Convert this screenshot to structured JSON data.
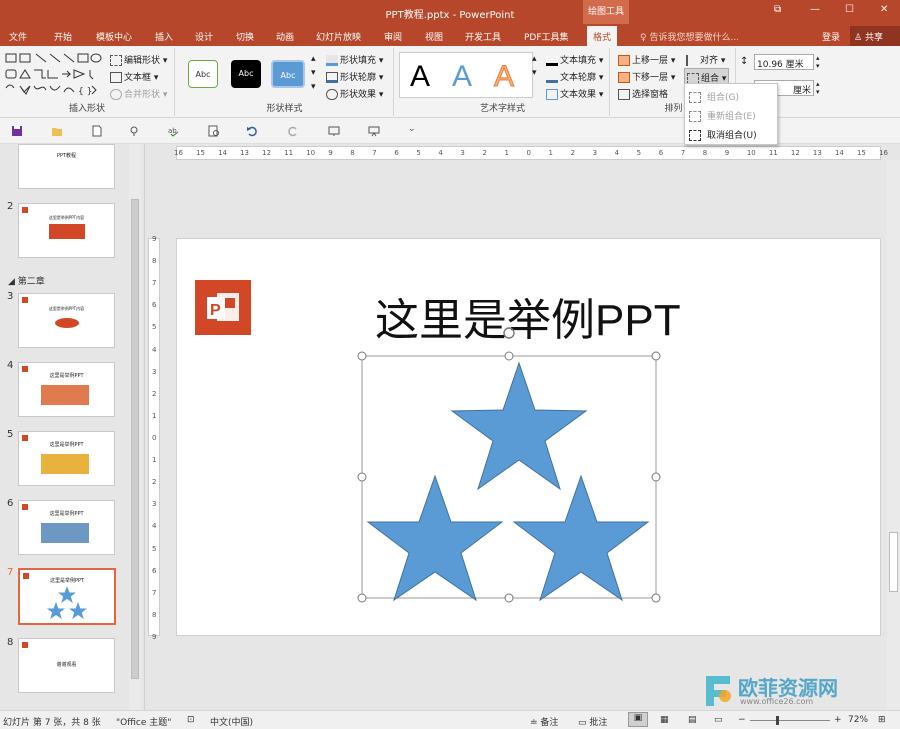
{
  "window": {
    "title": "PPT教程.pptx - PowerPoint",
    "context_tool": "绘图工具",
    "controls": {
      "restore": "⧉",
      "minimize": "—",
      "maximize": "☐",
      "close": "✕"
    }
  },
  "tabs": [
    "文件",
    "开始",
    "模板中心",
    "插入",
    "设计",
    "切换",
    "动画",
    "幻灯片放映",
    "审阅",
    "视图",
    "开发工具",
    "PDF工具集",
    "格式"
  ],
  "tell_me": "告诉我您想要做什么...",
  "login": "登录",
  "share": "共享",
  "ribbon": {
    "insert_shapes": {
      "label": "插入形状",
      "edit_shape": "编辑形状",
      "text_box": "文本框",
      "merge_shapes": "合并形状"
    },
    "shape_styles": {
      "label": "形状样式",
      "preset_1": "Abc",
      "preset_2": "Abc",
      "preset_3": "Abc",
      "fill": "形状填充",
      "outline": "形状轮廓",
      "effects": "形状效果"
    },
    "wordart_styles": {
      "label": "艺术字样式",
      "sample_a": "A",
      "text_fill": "文本填充",
      "text_outline": "文本轮廓",
      "text_effects": "文本效果"
    },
    "arrange": {
      "label": "排列",
      "bring_forward": "上移一层",
      "send_backward": "下移一层",
      "selection_pane": "选择窗格",
      "align": "对齐",
      "group": "组合"
    },
    "size": {
      "height": "10.96 厘米",
      "width": "厘米"
    }
  },
  "group_dropdown": {
    "items": [
      {
        "label": "组合(G)",
        "disabled": true
      },
      {
        "label": "重新组合(E)",
        "disabled": true
      },
      {
        "label": "取消组合(U)",
        "disabled": false
      }
    ]
  },
  "slides_panel": {
    "section_label": "第二章",
    "thumbs": [
      {
        "num": "",
        "text": "PPT教程"
      },
      {
        "num": "2",
        "text": "这里是举例PPT内容"
      },
      {
        "num": "3",
        "text": "这里是举例PPT内容"
      },
      {
        "num": "4",
        "text": "这里是举例PPT"
      },
      {
        "num": "5",
        "text": "这里是举例PPT"
      },
      {
        "num": "6",
        "text": "这里是举例PPT"
      },
      {
        "num": "7",
        "text": "这里是举例PPT"
      },
      {
        "num": "8",
        "text": "谢谢观看"
      }
    ],
    "selected": 7
  },
  "ruler": {
    "h_labels": [
      "16",
      "15",
      "14",
      "13",
      "12",
      "11",
      "10",
      "9",
      "8",
      "7",
      "6",
      "5",
      "4",
      "3",
      "2",
      "1",
      "0",
      "1",
      "2",
      "3",
      "4",
      "5",
      "6",
      "7",
      "8",
      "9",
      "10",
      "11",
      "12",
      "13",
      "14",
      "15",
      "16"
    ],
    "v_labels": [
      "9",
      "8",
      "7",
      "6",
      "5",
      "4",
      "3",
      "2",
      "1",
      "0",
      "1",
      "2",
      "3",
      "4",
      "5",
      "6",
      "7",
      "8",
      "9"
    ]
  },
  "slide": {
    "title": "这里是举例PPT",
    "star_color": "#5b9bd5",
    "logo_color": "#d24726"
  },
  "status": {
    "slide_info": "幻灯片 第 7 张，共 8 张",
    "theme": "\"Office 主题\"",
    "language": "中文(中国)",
    "notes": "备注",
    "comments": "批注",
    "zoom": "72%"
  },
  "watermark": {
    "brand": "欧菲资源网",
    "url": "www.office26.com"
  },
  "colors": {
    "accent": "#b7472a",
    "selected_border": "#e2673f"
  }
}
